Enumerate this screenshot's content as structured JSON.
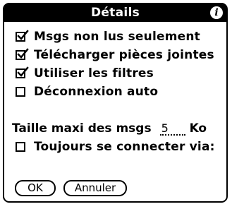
{
  "dialog": {
    "title": "Détails",
    "info_icon": "info-icon"
  },
  "options": [
    {
      "label": "Msgs non lus seulement",
      "checked": true
    },
    {
      "label": "Télécharger pièces jointes",
      "checked": true
    },
    {
      "label": "Utiliser les filtres",
      "checked": true
    },
    {
      "label": "Déconnexion auto",
      "checked": false
    }
  ],
  "max_size": {
    "label": "Taille maxi des msgs",
    "value": "5",
    "unit": "Ko"
  },
  "connect_via": {
    "label": "Toujours se connecter via:",
    "checked": false
  },
  "buttons": {
    "ok": "OK",
    "cancel": "Annuler"
  },
  "colors": {
    "foreground": "#000000",
    "background": "#ffffff"
  }
}
